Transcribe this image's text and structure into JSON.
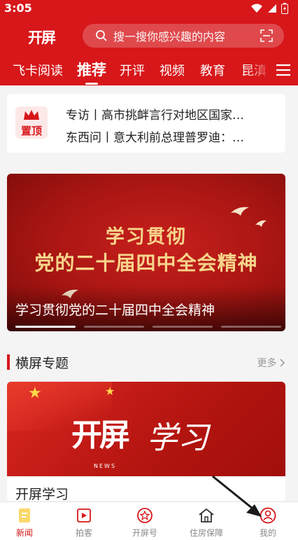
{
  "status_bar": {
    "time": "3:05"
  },
  "header": {
    "logo": "开屏",
    "search_placeholder": "搜一搜你感兴趣的内容"
  },
  "tabs": [
    {
      "label": "飞卡阅读"
    },
    {
      "label": "推荐",
      "active": true
    },
    {
      "label": "开评"
    },
    {
      "label": "视频"
    },
    {
      "label": "教育"
    },
    {
      "label": "昆滇"
    }
  ],
  "pinned": {
    "badge": "置顶",
    "items": [
      {
        "text": "专访丨高市挑衅言行对地区国家…"
      },
      {
        "text": "东西问丨意大利前总理普罗迪：…"
      }
    ]
  },
  "banner": {
    "art_line1": "学习贯彻",
    "art_line2": "党的二十届四中全会精神",
    "caption": "学习贯彻党的二十届四中全会精神",
    "slide_count": 4,
    "active_slide": 1
  },
  "section": {
    "title": "横屏专题",
    "more": "更多"
  },
  "topic_card": {
    "brand": "开屏",
    "brand_script": "学习",
    "brand_sub": "NEWS",
    "title": "开屏学习"
  },
  "bottom_nav": [
    {
      "label": "新闻",
      "icon": "news-icon",
      "active": true
    },
    {
      "label": "拍客",
      "icon": "video-icon"
    },
    {
      "label": "开屏号",
      "icon": "star-circle-icon"
    },
    {
      "label": "住房保障",
      "icon": "home-icon"
    },
    {
      "label": "我的",
      "icon": "user-icon"
    }
  ],
  "colors": {
    "brand_red": "#d7171a",
    "nav_inactive": "#888888"
  }
}
